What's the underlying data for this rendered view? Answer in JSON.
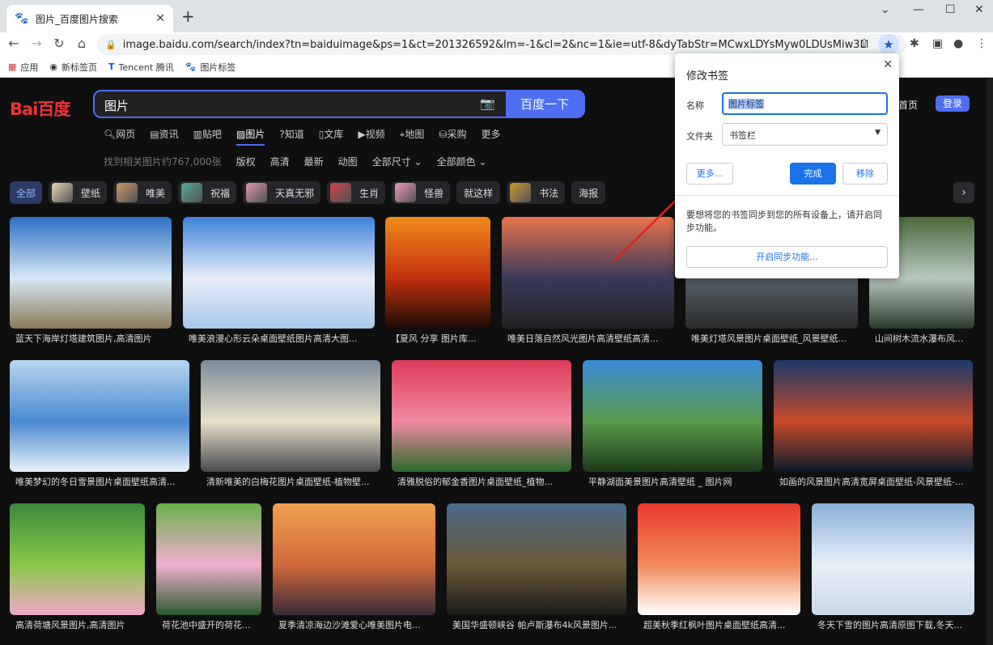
{
  "browser": {
    "tab_title": "图片_百度图片搜索",
    "url": "image.baidu.com/search/index?tn=baiduimage&ps=1&ct=201326592&lm=-1&cl=2&nc=1&ie=utf-8&dyTabStr=MCwxLDYsMyw0LDUsMiw3LDgsOQ%3...",
    "bookmarks": [
      {
        "icon": "apps-icon",
        "label": "应用"
      },
      {
        "icon": "globe-icon",
        "label": "新标签页"
      },
      {
        "icon": "tencent-icon",
        "label": "Tencent 腾讯"
      },
      {
        "icon": "baidu-paw-icon",
        "label": "图片标签"
      }
    ]
  },
  "page": {
    "logo": "Bai百度",
    "search_query": "图片",
    "search_button": "百度一下",
    "home_link": "首页",
    "login": "登录",
    "nav": [
      {
        "label": "网页",
        "icon": "search-icon"
      },
      {
        "label": "资讯",
        "icon": "news-icon"
      },
      {
        "label": "贴吧",
        "icon": "tieba-icon"
      },
      {
        "label": "图片",
        "icon": "image-icon"
      },
      {
        "label": "知道",
        "icon": "question-icon"
      },
      {
        "label": "文库",
        "icon": "doc-icon"
      },
      {
        "label": "视频",
        "icon": "video-icon"
      },
      {
        "label": "地图",
        "icon": "map-icon"
      },
      {
        "label": "采购",
        "icon": "cart-icon"
      },
      {
        "label": "更多",
        "icon": ""
      }
    ],
    "result_count": "找到相关图片约767,000张",
    "filters": [
      "版权",
      "高清",
      "最新",
      "动图",
      "全部尺寸 ⌄",
      "全部颜色 ⌄"
    ],
    "chips": [
      {
        "label": "全部",
        "thumb": ""
      },
      {
        "label": "壁纸",
        "thumb": "#e8d7b0"
      },
      {
        "label": "唯美",
        "thumb": "#c96"
      },
      {
        "label": "祝福",
        "thumb": "#5a9"
      },
      {
        "label": "天真无邪",
        "thumb": "#d9a"
      },
      {
        "label": "生肖",
        "thumb": "#c44"
      },
      {
        "label": "怪兽",
        "thumb": "#e9b"
      },
      {
        "label": "就这样",
        "thumb": ""
      },
      {
        "label": "书法",
        "thumb": "#c93"
      },
      {
        "label": "海报",
        "thumb": ""
      }
    ],
    "images": [
      {
        "caption": "蓝天下海岸灯塔建筑图片,高清图片",
        "colors": [
          "#2a6fc4",
          "#d8e8f5",
          "#8a7a5a"
        ]
      },
      {
        "caption": "唯美浪漫心形云朵桌面壁纸图片高清大图...",
        "colors": [
          "#3c82d8",
          "#e6eef8",
          "#a9c8ec"
        ]
      },
      {
        "caption": "【夏风 分享 图片库...",
        "colors": [
          "#f28a1c",
          "#c2300c",
          "#1a0a05"
        ]
      },
      {
        "caption": "唯美日落自然风光图片高清壁纸高清...",
        "colors": [
          "#e8734a",
          "#3a3a5a",
          "#222"
        ]
      },
      {
        "caption": "唯美灯塔风景图片桌面壁纸_风景壁纸...",
        "colors": [
          "#8aa6c0",
          "#56606a",
          "#2a2a2a"
        ]
      },
      {
        "caption": "山间树木流水瀑布风...",
        "colors": [
          "#4a6a3a",
          "#b8c8c0",
          "#2a3a2a"
        ]
      },
      {
        "caption": "唯美梦幻的冬日雪景图片桌面壁纸高清...",
        "colors": [
          "#b8d6f0",
          "#4a8ad0",
          "#e8f2fa"
        ]
      },
      {
        "caption": "清新唯美的白梅花图片桌面壁纸-植物壁...",
        "colors": [
          "#7a8a9a",
          "#e8e0c8",
          "#4a4a50"
        ]
      },
      {
        "caption": "清雅脱俗的郁金香图片桌面壁纸_植物...",
        "colors": [
          "#e03a5a",
          "#f08aa0",
          "#2a6a2a"
        ]
      },
      {
        "caption": "平静湖面美景图片高清壁纸 _ 图片网",
        "colors": [
          "#3a8ad8",
          "#5a9a4a",
          "#1a3a1a"
        ]
      },
      {
        "caption": "如画的风景图片高清宽屏桌面壁纸-风景壁纸-...",
        "colors": [
          "#1a3a6a",
          "#c84a2a",
          "#0a1a2a"
        ]
      },
      {
        "caption": "高清荷塘风景图片,高清图片",
        "colors": [
          "#3a8a3a",
          "#8ac84a",
          "#f0a8c8"
        ]
      },
      {
        "caption": "荷花池中盛开的荷花...",
        "colors": [
          "#6ab04a",
          "#f0b0d0",
          "#2a5a2a"
        ]
      },
      {
        "caption": "夏季清凉海边沙滩爱心唯美图片电...",
        "colors": [
          "#f0a050",
          "#d06a3a",
          "#3a2a3a"
        ]
      },
      {
        "caption": "美国华盛顿峡谷 帕卢斯瀑布4k风景图片...",
        "colors": [
          "#4a6a8a",
          "#6a5a3a",
          "#1a1a1a"
        ]
      },
      {
        "caption": "超美秋季红枫叶图片桌面壁纸高清...",
        "colors": [
          "#e83a2a",
          "#f08a5a",
          "#fff"
        ]
      },
      {
        "caption": "冬天下雪的图片高清原图下载,冬天...",
        "colors": [
          "#8ab0d8",
          "#e8f0f8",
          "#c8d8e8"
        ]
      }
    ]
  },
  "bookmark_dialog": {
    "title": "修改书签",
    "name_label": "名称",
    "name_value": "图片标签",
    "folder_label": "文件夹",
    "folder_value": "书签栏",
    "more_button": "更多...",
    "done_button": "完成",
    "remove_button": "移除",
    "sync_message": "要想将您的书签同步到您的所有设备上，请开启同步功能。",
    "sync_button": "开启同步功能..."
  },
  "colors": {
    "accent": "#4e6ef2",
    "chrome_blue": "#1a73e8",
    "annotation_arrow": "#e02020"
  }
}
